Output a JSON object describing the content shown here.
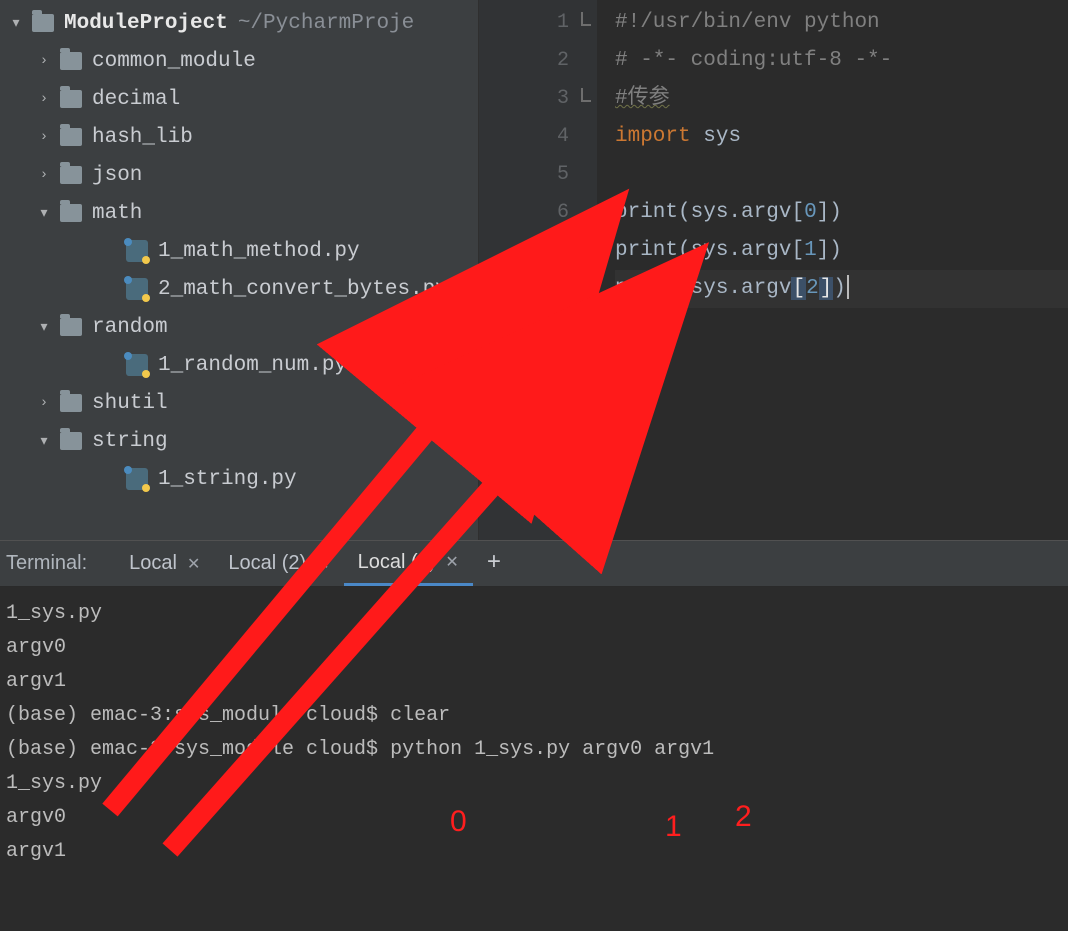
{
  "project": {
    "root_label": "ModuleProject",
    "root_path": "~/PycharmProje",
    "items": [
      {
        "chev": "right",
        "icon": "folder",
        "label": "common_module",
        "indent": 1
      },
      {
        "chev": "right",
        "icon": "folder",
        "label": "decimal",
        "indent": 1
      },
      {
        "chev": "right",
        "icon": "folder",
        "label": "hash_lib",
        "indent": 1
      },
      {
        "chev": "right",
        "icon": "folder",
        "label": "json",
        "indent": 1
      },
      {
        "chev": "down",
        "icon": "folder",
        "label": "math",
        "indent": 1
      },
      {
        "chev": "",
        "icon": "py",
        "label": "1_math_method.py",
        "indent": 2
      },
      {
        "chev": "",
        "icon": "py",
        "label": "2_math_convert_bytes.py",
        "indent": 2
      },
      {
        "chev": "down",
        "icon": "folder",
        "label": "random",
        "indent": 1
      },
      {
        "chev": "",
        "icon": "py",
        "label": "1_random_num.py",
        "indent": 2
      },
      {
        "chev": "right",
        "icon": "folder",
        "label": "shutil",
        "indent": 1
      },
      {
        "chev": "down",
        "icon": "folder",
        "label": "string",
        "indent": 1
      },
      {
        "chev": "",
        "icon": "py",
        "label": "1_string.py",
        "indent": 2
      }
    ]
  },
  "editor": {
    "line_numbers": [
      "1",
      "2",
      "3",
      "4",
      "5",
      "6",
      "7",
      "8",
      "9",
      "10"
    ],
    "lines": {
      "l1": "#!/usr/bin/env python",
      "l2": "# -*- coding:utf-8 -*-",
      "l3": "#传参",
      "l4_kw": "import",
      "l4_mod": "sys",
      "l6_fn": "print",
      "l6_obj": "sys.argv",
      "l6_idx": "0",
      "l7_fn": "print",
      "l7_obj": "sys.argv",
      "l7_idx": "1",
      "l8_fn": "print",
      "l8_obj": "sys.argv",
      "l8_idx": "2"
    }
  },
  "terminal": {
    "title": "Terminal:",
    "tabs": [
      {
        "label": "Local",
        "active": false
      },
      {
        "label": "Local (2)",
        "active": false
      },
      {
        "label": "Local (3)",
        "active": true
      }
    ],
    "output": [
      "1_sys.py",
      "argv0",
      "argv1",
      "(base) emac-3:sys_module cloud$ clear",
      "(base) emac-3:sys_module cloud$ python 1_sys.py argv0 argv1",
      "1_sys.py",
      "argv0",
      "argv1"
    ]
  },
  "annotations": {
    "numbers": [
      "0",
      "1",
      "2"
    ]
  }
}
